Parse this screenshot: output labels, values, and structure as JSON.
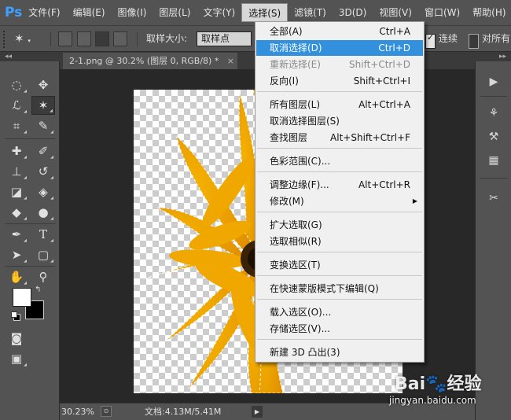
{
  "app": {
    "logo": "Ps"
  },
  "menubar": {
    "items": [
      "文件(F)",
      "编辑(E)",
      "图像(I)",
      "图层(L)",
      "文字(Y)",
      "选择(S)",
      "滤镜(T)",
      "3D(D)",
      "视图(V)",
      "窗口(W)",
      "帮助(H)"
    ],
    "active_index": 5
  },
  "options": {
    "sample_size_label": "取样大小:",
    "sample_size_value": "取样点",
    "contiguous_label": "连续",
    "contiguous_checked": true,
    "all_layers_label": "对所有",
    "all_layers_checked": false
  },
  "document": {
    "tab_title": "2-1.png @ 30.2% (图层 0, RGB/8) *",
    "close_glyph": "×",
    "zoom": "30.23%",
    "doc_size": "文档:4.13M/5.41M",
    "status_arrow": "▶",
    "status_icon": "⊙"
  },
  "select_menu": {
    "items": [
      {
        "label": "全部(A)",
        "shortcut": "Ctrl+A"
      },
      {
        "label": "取消选择(D)",
        "shortcut": "Ctrl+D",
        "highlighted": true
      },
      {
        "label": "重新选择(E)",
        "shortcut": "Shift+Ctrl+D",
        "disabled": true
      },
      {
        "label": "反向(I)",
        "shortcut": "Shift+Ctrl+I"
      },
      {
        "label": "所有图层(L)",
        "shortcut": "Alt+Ctrl+A"
      },
      {
        "label": "取消选择图层(S)",
        "shortcut": ""
      },
      {
        "label": "查找图层",
        "shortcut": "Alt+Shift+Ctrl+F"
      },
      {
        "label": "色彩范围(C)...",
        "shortcut": ""
      },
      {
        "label": "调整边缘(F)...",
        "shortcut": "Alt+Ctrl+R"
      },
      {
        "label": "修改(M)",
        "shortcut": "",
        "submenu": true
      },
      {
        "label": "扩大选取(G)",
        "shortcut": ""
      },
      {
        "label": "选取相似(R)",
        "shortcut": ""
      },
      {
        "label": "变换选区(T)",
        "shortcut": ""
      },
      {
        "label": "在快速蒙版模式下编辑(Q)",
        "shortcut": ""
      },
      {
        "label": "载入选区(O)...",
        "shortcut": ""
      },
      {
        "label": "存储选区(V)...",
        "shortcut": ""
      },
      {
        "label": "新建 3D 凸出(3)",
        "shortcut": ""
      }
    ]
  },
  "panels": {
    "collapse_glyph": "◂◂",
    "expand_glyph": "▸▸"
  },
  "colors": {
    "accent": "#3390dd",
    "foreground": "#ffffff",
    "background": "#000000"
  },
  "watermark": {
    "logo": "Bai🐾经验",
    "url": "jingyan.baidu.com"
  }
}
